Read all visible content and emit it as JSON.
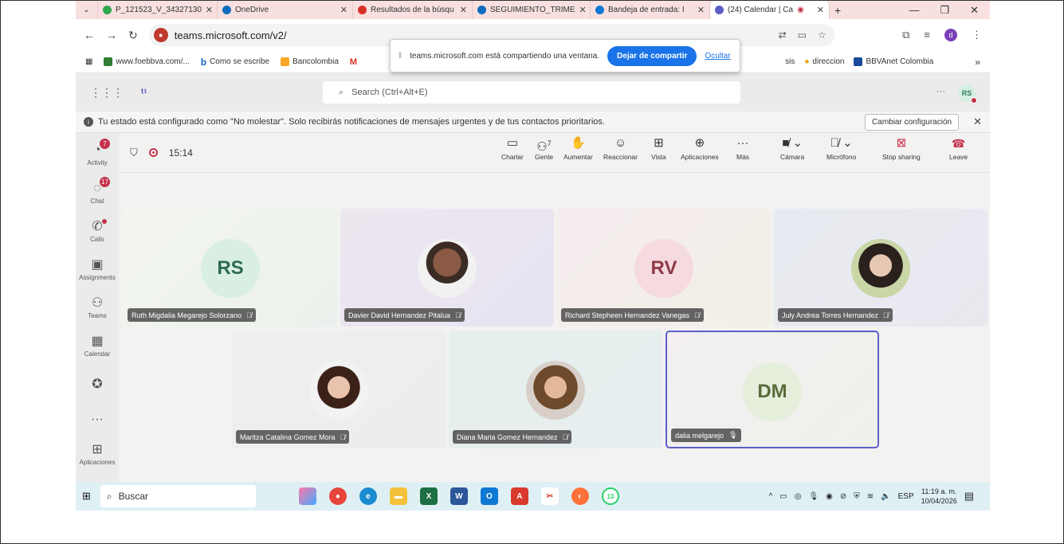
{
  "browser": {
    "tabs": [
      {
        "label": "P_121523_V_34327130",
        "color": "#2fa84f"
      },
      {
        "label": "OneDrive",
        "color": "#0f6cbd"
      },
      {
        "label": "Resultados de la búsqu",
        "color": "#d93025"
      },
      {
        "label": "SEGUIMIENTO_TRIME",
        "color": "#0f6cbd"
      },
      {
        "label": "Bandeja de entrada: I",
        "color": "#0f78d4"
      },
      {
        "label": "(24) Calendar | Ca",
        "color": "#5b5fc7"
      }
    ],
    "url": "teams.microsoft.com/v2/",
    "profile_letter": "d",
    "bookmarks": [
      {
        "label": "www.foebbva.com/...",
        "color": "#2e7d32"
      },
      {
        "label": "Como se escribe",
        "color": "#1565c0",
        "glyph": "b"
      },
      {
        "label": "Bancolombia",
        "color": "#f9a825"
      },
      {
        "label": "",
        "color": "#d93025",
        "glyph": "M"
      }
    ],
    "bookmarks_right": [
      {
        "label": "sis"
      },
      {
        "label": "direccion"
      },
      {
        "label": "BBVAnet Colombia"
      }
    ],
    "share_popup": {
      "message": "teams.microsoft.com está compartiendo una ventana.",
      "stop_label": "Dejar de compartir",
      "hide_label": "Ocultar"
    }
  },
  "teams": {
    "search_placeholder": "Search (Ctrl+Alt+E)",
    "user_initials": "RS",
    "banner": {
      "text": "Tu estado está configurado como \"No molestar\". Solo recibirás notificaciones de mensajes urgentes y de tus contactos prioritarios.",
      "button": "Cambiar configuración"
    },
    "rail": [
      {
        "label": "Activity",
        "icon": "bell-icon",
        "glyph": "🔔",
        "badge": "7"
      },
      {
        "label": "Chat",
        "icon": "chat-icon",
        "glyph": "💬",
        "badge": "17"
      },
      {
        "label": "Calls",
        "icon": "phone-icon",
        "glyph": "✆",
        "dot": true
      },
      {
        "label": "Assignments",
        "icon": "assignments-icon",
        "glyph": "🎒"
      },
      {
        "label": "Teams",
        "icon": "teams-icon",
        "glyph": "👥"
      },
      {
        "label": "Calendar",
        "icon": "calendar-icon",
        "glyph": "📅"
      },
      {
        "label": "",
        "icon": "copilot-icon",
        "glyph": "✪"
      },
      {
        "label": "",
        "icon": "more-icon",
        "glyph": "•••"
      },
      {
        "label": "Aplicaciones",
        "icon": "add-apps-icon",
        "glyph": "⊞"
      }
    ],
    "meeting": {
      "time": "15:14",
      "people_count": "7",
      "toolbar": {
        "chat": "Charlar",
        "people": "Gente",
        "raise": "Aumentar",
        "react": "Reaccionar",
        "view": "Vista",
        "apps": "Aplicaciones",
        "more": "Más",
        "camera": "Cámara",
        "mic": "Micrófono",
        "stop_sharing": "Stop sharing",
        "leave": "Leave"
      },
      "participants": [
        {
          "name": "Ruth Migdalia Megarejo Solorzano",
          "initials": "RS",
          "bg": "#d9efe3",
          "fg": "#2e6b4f",
          "tile": "#eef3ee"
        },
        {
          "name": "Davier David Hernandez Pitalua",
          "initials": "",
          "photo": "#6b4a3a",
          "tile": "#ebe6ef"
        },
        {
          "name": "Richard Stepheen Hernandez Vanegas",
          "initials": "RV",
          "bg": "#f5dbdf",
          "fg": "#8f3a46",
          "tile": "#f4eaea"
        },
        {
          "name": "July Andrea Torres Hernandez",
          "initials": "",
          "photo": "#3a2c26",
          "tile": "#e7ebf1"
        },
        {
          "name": "Maritza Catalina Gomez Mora",
          "initials": "",
          "photo": "#4a2e24",
          "tile": "#eef0ef"
        },
        {
          "name": "Diana Maria Gomez Hernandez",
          "initials": "",
          "photo": "#6e4a2c",
          "tile": "#e6efec"
        },
        {
          "name": "dalia melgarejo",
          "initials": "DM",
          "bg": "#e6efdc",
          "fg": "#5a6b3a",
          "tile": "#f1eef3"
        }
      ]
    }
  },
  "taskbar": {
    "search": "Buscar",
    "whatsapp_badge": "13",
    "lang": "ESP",
    "time": "11:19 a. m.",
    "date": "10/04/2026"
  }
}
